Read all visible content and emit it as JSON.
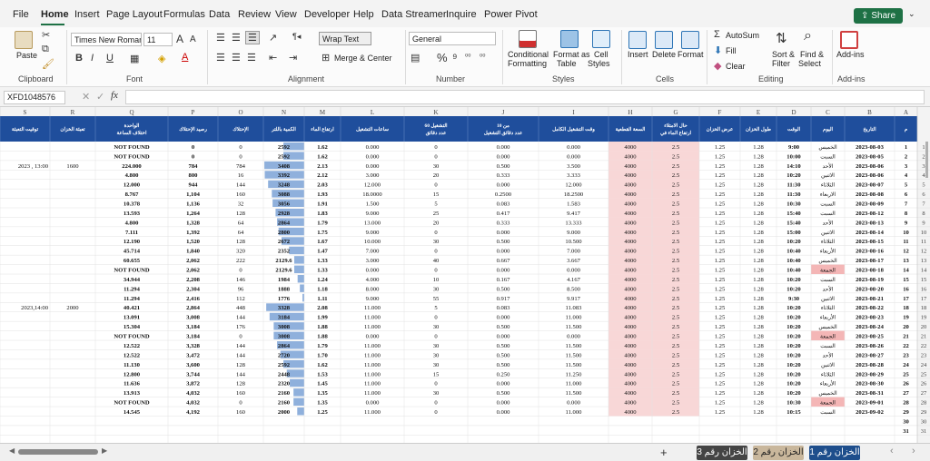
{
  "menu": {
    "tabs": [
      "File",
      "Home",
      "Insert",
      "Page Layout",
      "Formulas",
      "Data",
      "Review",
      "View",
      "Developer",
      "Help",
      "Data Streamer",
      "Inquire",
      "Power Pivot"
    ],
    "share_label": "Share"
  },
  "ribbon": {
    "groups": [
      "Clipboard",
      "Font",
      "Alignment",
      "Number",
      "Styles",
      "Cells",
      "Editing",
      "Add-ins"
    ],
    "paste": "Paste",
    "font_name": "Times New Roman",
    "font_size": "11",
    "bold": "B",
    "italic": "I",
    "underline": "U",
    "wrap_text": "Wrap Text",
    "merge_center": "Merge & Center",
    "number_format": "General",
    "conditional_formatting": [
      "Conditional",
      "Formatting"
    ],
    "format_as_table": [
      "Format as",
      "Table"
    ],
    "cell_styles": [
      "Cell",
      "Styles"
    ],
    "insert": "Insert",
    "delete": "Delete",
    "format": "Format",
    "autosum": "AutoSum",
    "fill": "Fill",
    "clear": "Clear",
    "sort_filter": [
      "Sort &",
      "Filter"
    ],
    "find_select": [
      "Find &",
      "Select"
    ],
    "addins": "Add-ins",
    "font_grow": "A",
    "font_shrink": "A",
    "fx": "fx"
  },
  "formula_bar": {
    "name_box": "XFD1048576",
    "formula": ""
  },
  "sheet": {
    "columns": [
      "A",
      "B",
      "C",
      "D",
      "E",
      "F",
      "G",
      "H",
      "I",
      "J",
      "K",
      "L",
      "M",
      "N",
      "O",
      "P",
      "Q",
      "R",
      "S"
    ],
    "header_row": [
      "م",
      "التاريخ",
      "اليوم",
      "الوقت",
      "طول الخزان",
      "عرض الخزان",
      "ارتفاع الماء في حال الامتلاء",
      "السعة القطعية",
      "وقت التشغيل الكامل",
      "عدد دقائق التشغيل من 10",
      "عدد دقائق التشغيل 60",
      "ساعات التشغيل",
      "ارتفاع الماء",
      "الكمية باللتر",
      "الإحتلاك",
      "رصيد الإحتلاك",
      "اختلاف الساعة الواحدة",
      "تعبئة الخزان",
      "توقيت التعبئة"
    ],
    "row_numbers": [
      1,
      2,
      3,
      4,
      5,
      6,
      7,
      8,
      9,
      10,
      11,
      12,
      13,
      14,
      15,
      16,
      17,
      18,
      19,
      20,
      21,
      22,
      23,
      24,
      25,
      26,
      27,
      28,
      29,
      30,
      31
    ],
    "rows": [
      [
        "1",
        "2023-08-03",
        "الخميس",
        "9:00",
        "1.28",
        "1.25",
        "2.5",
        "4000",
        "0.000",
        "0.000",
        "0",
        "0.000",
        "1.62",
        "2592",
        "0",
        "0",
        "NOT FOUND",
        "",
        ""
      ],
      [
        "2",
        "2023-08-05",
        "السبت",
        "10:00",
        "1.28",
        "1.25",
        "2.5",
        "4000",
        "0.000",
        "0.000",
        "0",
        "0.000",
        "1.62",
        "2592",
        "0",
        "0",
        "NOT FOUND",
        "",
        ""
      ],
      [
        "3",
        "2023-08-06",
        "الأحد",
        "14:10",
        "1.28",
        "1.25",
        "2.5",
        "4000",
        "3.500",
        "0.500",
        "30",
        "0.000",
        "2.13",
        "3408",
        "784",
        "784",
        "224.000",
        "1600",
        "2023 , 13:00"
      ],
      [
        "4",
        "2023-08-06",
        "الاثنين",
        "10:20",
        "1.28",
        "1.25",
        "2.5",
        "4000",
        "3.333",
        "0.333",
        "20",
        "3.000",
        "2.12",
        "3392",
        "16",
        "800",
        "4.800",
        "",
        ""
      ],
      [
        "5",
        "2023-08-07",
        "الثلاثاء",
        "11:30",
        "1.28",
        "1.25",
        "2.5",
        "4000",
        "12.000",
        "0.000",
        "0",
        "12.000",
        "2.03",
        "3248",
        "144",
        "944",
        "12.000",
        "",
        ""
      ],
      [
        "6",
        "2023-08-08",
        "الاربعاء",
        "11:30",
        "1.28",
        "1.25",
        "2.5",
        "4000",
        "18.2500",
        "0.2500",
        "15",
        "18.0000",
        "1.93",
        "3088",
        "160",
        "1,104",
        "8.767",
        "",
        ""
      ],
      [
        "7",
        "2023-08-09",
        "السبت",
        "10:30",
        "1.28",
        "1.25",
        "2.5",
        "4000",
        "1.583",
        "0.083",
        "5",
        "1.500",
        "1.91",
        "3056",
        "32",
        "1,136",
        "10.378",
        "",
        ""
      ],
      [
        "8",
        "2023-08-12",
        "السبت",
        "15:40",
        "1.28",
        "1.25",
        "2.5",
        "4000",
        "9.417",
        "0.417",
        "25",
        "9.000",
        "1.83",
        "2928",
        "128",
        "1,264",
        "13.593",
        "",
        ""
      ],
      [
        "9",
        "2023-08-13",
        "الأحد",
        "15:40",
        "1.28",
        "1.25",
        "2.5",
        "4000",
        "13.333",
        "0.333",
        "20",
        "13.000",
        "1.79",
        "2864",
        "64",
        "1,328",
        "4.800",
        "",
        ""
      ],
      [
        "10",
        "2023-08-14",
        "الاثنين",
        "15:00",
        "1.28",
        "1.25",
        "2.5",
        "4000",
        "9.000",
        "0.000",
        "0",
        "9.000",
        "1.75",
        "2800",
        "64",
        "1,392",
        "7.111",
        "",
        ""
      ],
      [
        "11",
        "2023-08-15",
        "الثلاثاء",
        "10:20",
        "1.28",
        "1.25",
        "2.5",
        "4000",
        "10.500",
        "0.500",
        "30",
        "10.000",
        "1.67",
        "2672",
        "128",
        "1,520",
        "12.190",
        "",
        ""
      ],
      [
        "12",
        "2023-08-16",
        "الأربعاء",
        "10:40",
        "1.28",
        "1.25",
        "2.5",
        "4000",
        "7.000",
        "0.000",
        "0",
        "7.000",
        "1.47",
        "2352",
        "320",
        "1,840",
        "45.714",
        "",
        ""
      ],
      [
        "13",
        "2023-08-17",
        "الخميس",
        "10:40",
        "1.28",
        "1.25",
        "2.5",
        "4000",
        "3.667",
        "0.667",
        "40",
        "3.000",
        "1.33",
        "2129.6",
        "222",
        "2,062",
        "60.655",
        "",
        ""
      ],
      [
        "14",
        "2023-08-18",
        "الجمعة",
        "10:40",
        "1.28",
        "1.25",
        "2.5",
        "4000",
        "0.000",
        "0.000",
        "0",
        "0.000",
        "1.33",
        "2129.6",
        "0",
        "2,062",
        "NOT FOUND",
        "",
        ""
      ],
      [
        "15",
        "2023-08-19",
        "السبت",
        "10:20",
        "1.28",
        "1.25",
        "2.5",
        "4000",
        "4.167",
        "0.167",
        "10",
        "4.000",
        "1.24",
        "1984",
        "146",
        "2,208",
        "34.944",
        "",
        ""
      ],
      [
        "16",
        "2023-08-20",
        "الأحد",
        "10:20",
        "1.28",
        "1.25",
        "2.5",
        "4000",
        "8.500",
        "0.500",
        "30",
        "8.000",
        "1.18",
        "1888",
        "96",
        "2,304",
        "11.294",
        "",
        ""
      ],
      [
        "17",
        "2023-08-21",
        "الاثنين",
        "9:30",
        "1.28",
        "1.25",
        "2.5",
        "4000",
        "9.917",
        "0.917",
        "55",
        "9.000",
        "1.11",
        "1776",
        "112",
        "2,416",
        "11.294",
        "",
        ""
      ],
      [
        "18",
        "2023-08-22",
        "الثلاثاء",
        "10:20",
        "1.28",
        "1.25",
        "2.5",
        "4000",
        "11.083",
        "0.083",
        "5",
        "11.000",
        "2.08",
        "3328",
        "448",
        "2,864",
        "40.421",
        "2000",
        "2023,14:00"
      ],
      [
        "19",
        "2023-08-23",
        "الأربعاء",
        "10:20",
        "1.28",
        "1.25",
        "2.5",
        "4000",
        "11.000",
        "0.000",
        "0",
        "11.000",
        "1.99",
        "3184",
        "144",
        "3,008",
        "13.091",
        "",
        ""
      ],
      [
        "20",
        "2023-08-24",
        "الخميس",
        "10:20",
        "1.28",
        "1.25",
        "2.5",
        "4000",
        "11.500",
        "0.500",
        "30",
        "11.000",
        "1.88",
        "3008",
        "176",
        "3,184",
        "15.304",
        "",
        ""
      ],
      [
        "21",
        "2023-08-25",
        "الجمعة",
        "10:20",
        "1.28",
        "1.25",
        "2.5",
        "4000",
        "0.000",
        "0.000",
        "0",
        "0.000",
        "1.88",
        "3008",
        "0",
        "3,184",
        "NOT FOUND",
        "",
        ""
      ],
      [
        "22",
        "2023-08-26",
        "السبت",
        "10:20",
        "1.28",
        "1.25",
        "2.5",
        "4000",
        "11.500",
        "0.500",
        "30",
        "11.000",
        "1.79",
        "2864",
        "144",
        "3,328",
        "12.522",
        "",
        ""
      ],
      [
        "23",
        "2023-08-27",
        "الأحد",
        "10:20",
        "1.28",
        "1.25",
        "2.5",
        "4000",
        "11.500",
        "0.500",
        "30",
        "11.000",
        "1.70",
        "2720",
        "144",
        "3,472",
        "12.522",
        "",
        ""
      ],
      [
        "24",
        "2023-08-28",
        "الاثنين",
        "10:20",
        "1.28",
        "1.25",
        "2.5",
        "4000",
        "11.500",
        "0.500",
        "30",
        "11.000",
        "1.62",
        "2592",
        "128",
        "3,600",
        "11.130",
        "",
        ""
      ],
      [
        "25",
        "2023-08-29",
        "الثلاثاء",
        "10:20",
        "1.28",
        "1.25",
        "2.5",
        "4000",
        "11.250",
        "0.250",
        "15",
        "11.000",
        "1.53",
        "2448",
        "144",
        "3,744",
        "12.800",
        "",
        ""
      ],
      [
        "26",
        "2023-08-30",
        "الأربعاء",
        "10:20",
        "1.28",
        "1.25",
        "2.5",
        "4000",
        "11.000",
        "0.000",
        "0",
        "11.000",
        "1.45",
        "2320",
        "128",
        "3,872",
        "11.636",
        "",
        ""
      ],
      [
        "27",
        "2023-08-31",
        "الخميس",
        "10:20",
        "1.28",
        "1.25",
        "2.5",
        "4000",
        "11.500",
        "0.500",
        "30",
        "11.000",
        "1.35",
        "2160",
        "160",
        "4,032",
        "13.913",
        "",
        ""
      ],
      [
        "28",
        "2023-09-01",
        "الجمعة",
        "10:30",
        "1.28",
        "1.25",
        "2.5",
        "4000",
        "0.000",
        "0.000",
        "0",
        "0.000",
        "1.35",
        "2160",
        "0",
        "4,032",
        "NOT FOUND",
        "",
        ""
      ],
      [
        "29",
        "2023-09-02",
        "السبت",
        "10:15",
        "1.28",
        "1.25",
        "2.5",
        "4000",
        "11.000",
        "0.000",
        "0",
        "11.000",
        "1.25",
        "2000",
        "160",
        "4,192",
        "14.545",
        "",
        ""
      ],
      [
        "30",
        "",
        "",
        "",
        "",
        "",
        "",
        "",
        "",
        "",
        "",
        "",
        "",
        "",
        "",
        "",
        "",
        "",
        ""
      ],
      [
        "31",
        "",
        "",
        "",
        "",
        "",
        "",
        "",
        "",
        "",
        "",
        "",
        "",
        "",
        "",
        "",
        "",
        "",
        ""
      ]
    ]
  },
  "sheet_tabs": [
    "الخزان رقم 1",
    "الخزان رقم 2",
    "الخزان رقم 3"
  ],
  "add_sheet": "+",
  "colors": {
    "accent": "#1e7145",
    "pink": "#f8d7d7",
    "blue_bar": "#8fb0dc",
    "tab_dark": "#444444",
    "tab_active": "#1e4e8c"
  }
}
